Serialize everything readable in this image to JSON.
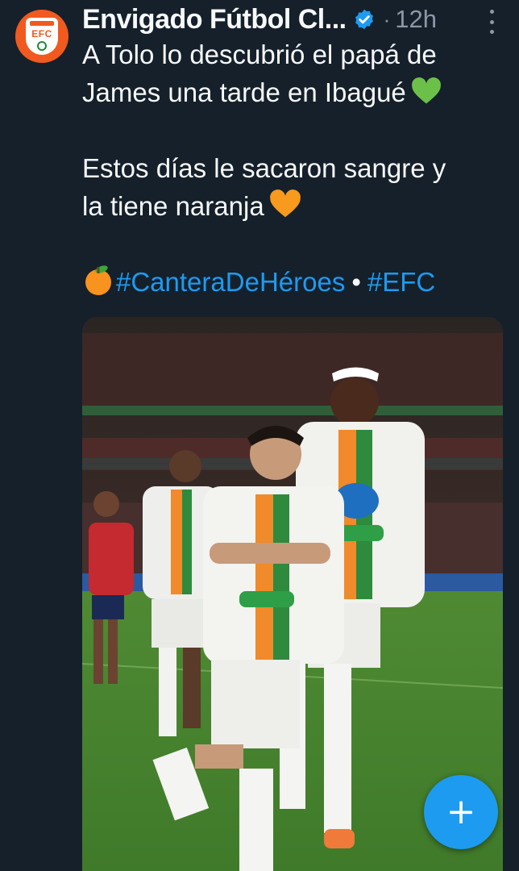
{
  "tweet": {
    "author_name": "Envigado Fútbol Cl...",
    "time": "12h",
    "separator": "·",
    "avatar_text": "EFC",
    "lines": {
      "line1": "A Tolo lo descubrió el papá de",
      "line2": "James una tarde en Ibagué",
      "line3": "Estos días le sacaron sangre y",
      "line4": "la tiene naranja"
    },
    "hashtags": {
      "tag1": "#CanteraDeHéroes",
      "separator": "•",
      "tag2": "#EFC"
    },
    "icons": {
      "verified": "verified-badge-icon",
      "more": "more-options-icon",
      "green_heart": "green-heart-emoji",
      "orange_heart": "orange-heart-emoji",
      "tangerine": "tangerine-emoji"
    }
  },
  "fab": {
    "label": "+"
  },
  "colors": {
    "background": "#15202b",
    "text": "#f7f9f9",
    "muted": "#8b98a5",
    "link": "#1d9bf0",
    "brand_orange": "#f05a1e"
  }
}
